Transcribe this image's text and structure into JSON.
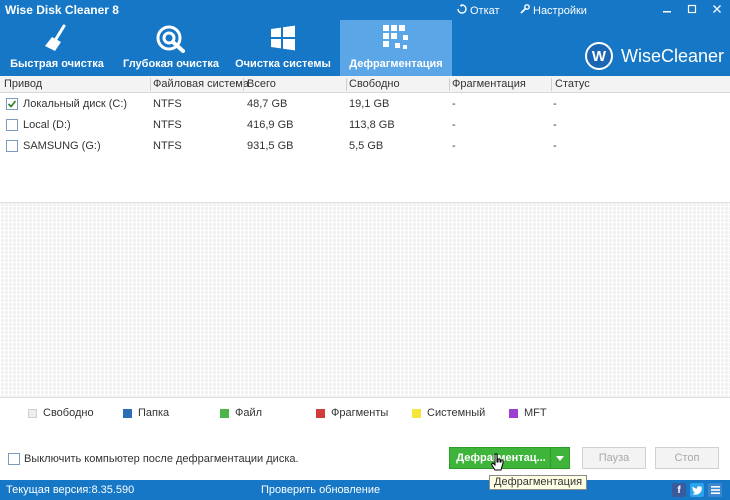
{
  "app": {
    "title": "Wise Disk Cleaner 8"
  },
  "titlebar": {
    "rollback_label": "Откат",
    "settings_label": "Настройки"
  },
  "tabs": [
    {
      "label": "Быстрая очистка",
      "icon": "broom-icon",
      "active": false
    },
    {
      "label": "Глубокая очистка",
      "icon": "deep-clean-icon",
      "active": false
    },
    {
      "label": "Очистка системы",
      "icon": "windows-icon",
      "active": false
    },
    {
      "label": "Дефрагментация",
      "icon": "defrag-icon",
      "active": true
    }
  ],
  "brand": {
    "logo_letter": "W",
    "name": "WiseCleaner"
  },
  "table": {
    "headers": [
      "Привод",
      "Файловая система",
      "Всего",
      "Свободно",
      "Фрагментация",
      "Статус"
    ],
    "rows": [
      {
        "checked": true,
        "drive": "Локальный диск (C:)",
        "fs": "NTFS",
        "total": "48,7 GB",
        "free": "19,1 GB",
        "frag": "-",
        "status": "-"
      },
      {
        "checked": false,
        "drive": "Local (D:)",
        "fs": "NTFS",
        "total": "416,9 GB",
        "free": "113,8 GB",
        "frag": "-",
        "status": "-"
      },
      {
        "checked": false,
        "drive": "SAMSUNG (G:)",
        "fs": "NTFS",
        "total": "931,5 GB",
        "free": "5,5 GB",
        "frag": "-",
        "status": "-"
      }
    ]
  },
  "legend": [
    {
      "label": "Свободно",
      "color": "#eeeeee"
    },
    {
      "label": "Папка",
      "color": "#2a6fb5"
    },
    {
      "label": "Файл",
      "color": "#4cb748"
    },
    {
      "label": "Фрагменты",
      "color": "#d23b3b"
    },
    {
      "label": "Системный",
      "color": "#f5e63b"
    },
    {
      "label": "MFT",
      "color": "#9c3fd0"
    }
  ],
  "controls": {
    "shutdown_label": "Выключить компьютер после дефрагментации диска.",
    "defrag_label": "Дефрагментац...",
    "pause_label": "Пауза",
    "stop_label": "Стоп",
    "tooltip": "Дефрагментация"
  },
  "statusbar": {
    "version": "Текущая версия:8.35.590",
    "update_label": "Проверить обновление"
  },
  "colors": {
    "header": "#1577c6",
    "active_tab": "#5aa6e6",
    "defrag_button": "#3fb43a"
  }
}
